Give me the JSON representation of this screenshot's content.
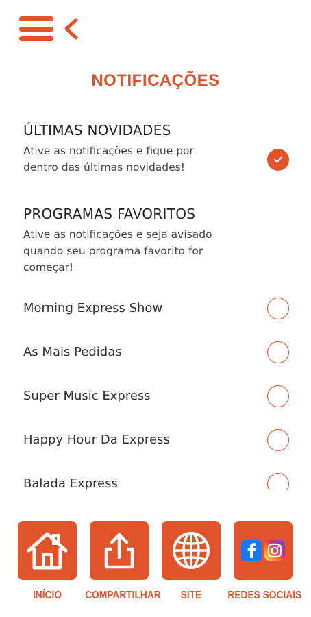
{
  "header": {
    "title": "NOTIFICAÇÕES"
  },
  "latest": {
    "title": "ÚLTIMAS NOVIDADES",
    "desc_line1": "Ative as notificações e fique por",
    "desc_line2": "dentro das últimas novidades!",
    "checked": true
  },
  "favorites": {
    "title": "PROGRAMAS FAVORITOS",
    "desc_line1": "Ative as notificações e seja avisado",
    "desc_line2": "quando seu programa favorito for",
    "desc_line3": "começar!",
    "programs": [
      {
        "label": "Morning Express Show",
        "checked": false
      },
      {
        "label": "As Mais Pedidas",
        "checked": false
      },
      {
        "label": "Super Music Express",
        "checked": false
      },
      {
        "label": "Happy Hour Da Express",
        "checked": false
      },
      {
        "label": "Balada Express",
        "checked": false
      }
    ]
  },
  "bottom_nav": [
    {
      "label": "INÍCIO",
      "icon": "home-icon"
    },
    {
      "label": "COMPARTILHAR",
      "icon": "share-icon"
    },
    {
      "label": "SITE",
      "icon": "globe-icon"
    },
    {
      "label": "REDES SOCIAIS",
      "icon": "social-icon"
    }
  ],
  "colors": {
    "accent": "#e0532b",
    "facebook": "#1877f2",
    "instagram": "#c13584"
  }
}
